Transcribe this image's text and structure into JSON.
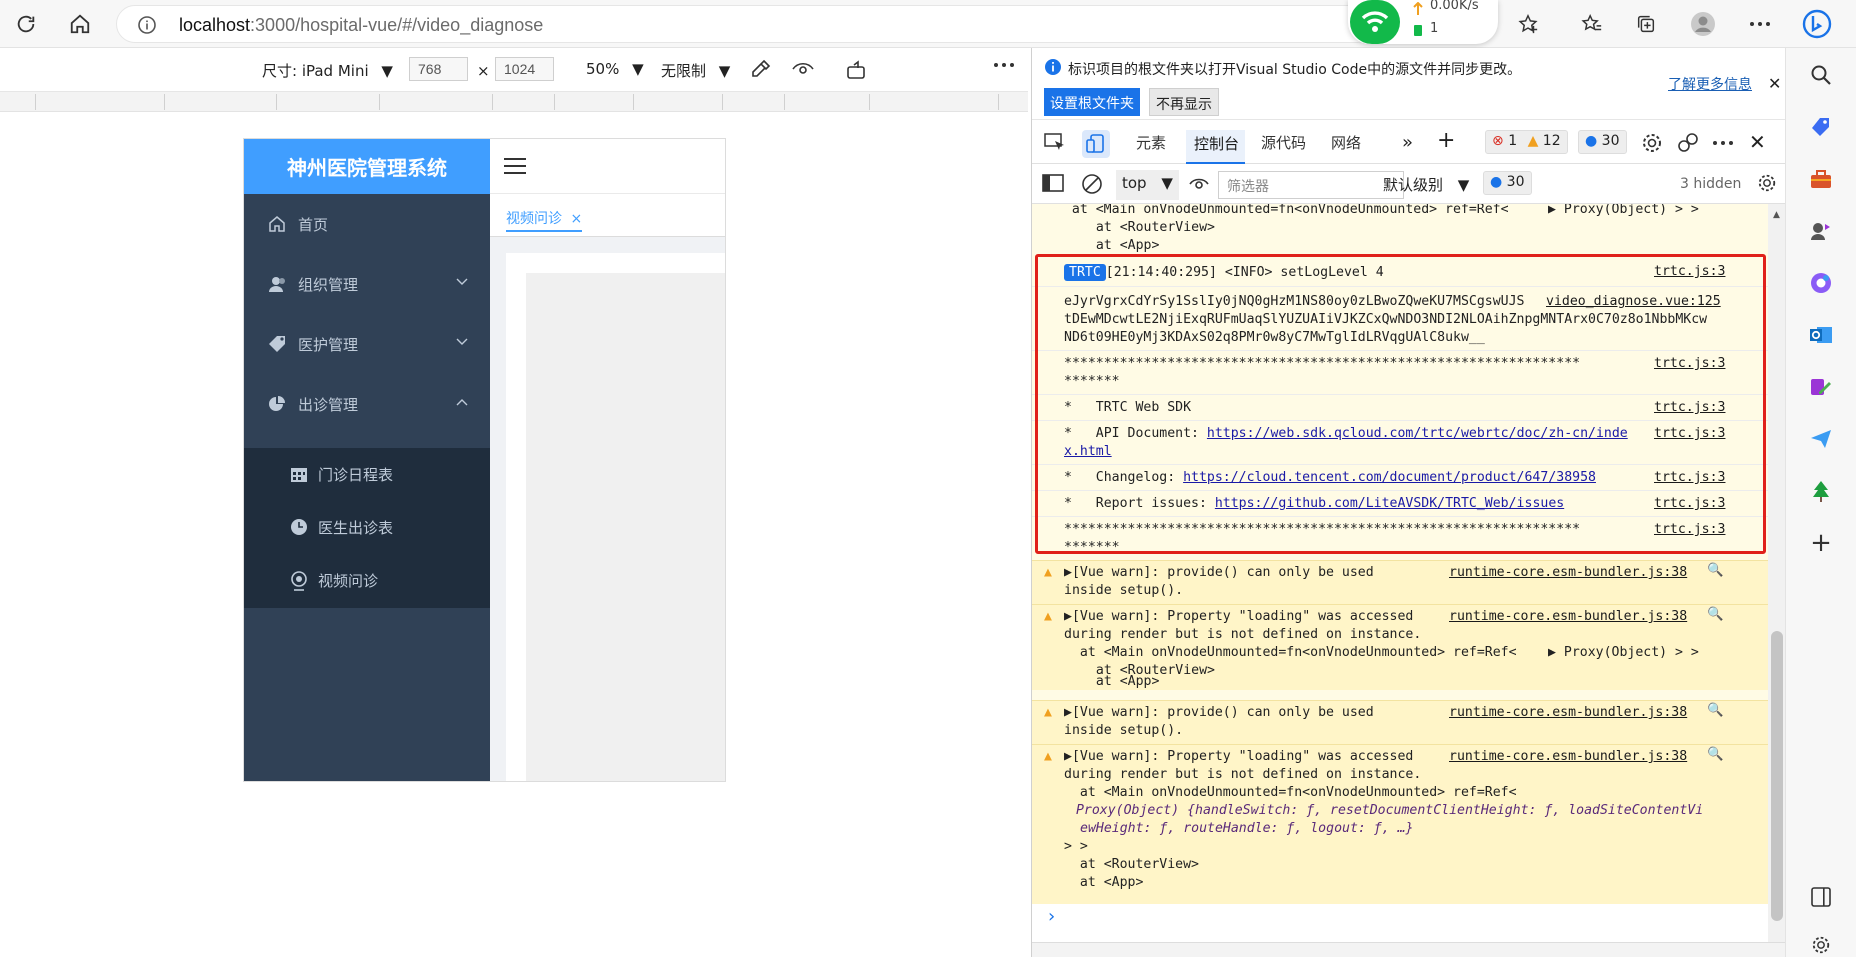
{
  "browser": {
    "url_host": "localhost",
    "url_path": ":3000/hospital-vue/#/video_diagnose",
    "net_speed": "0.00K/s",
    "net_count": "1"
  },
  "device_toolbar": {
    "size_label": "尺寸: iPad Mini",
    "width": "768",
    "times": "×",
    "height": "1024",
    "zoom": "50%",
    "throttle": "无限制"
  },
  "app": {
    "title": "神州医院管理系统",
    "menu": [
      {
        "label": "首页"
      },
      {
        "label": "组织管理"
      },
      {
        "label": "医护管理"
      },
      {
        "label": "出诊管理"
      }
    ],
    "submenu": [
      {
        "label": "门诊日程表"
      },
      {
        "label": "医生出诊表"
      },
      {
        "label": "视频问诊"
      }
    ],
    "tab_label": "视频问诊",
    "tab_close": "×"
  },
  "devtools": {
    "info_message": "标识项目的根文件夹以打开Visual Studio Code中的源文件并同步更改。",
    "set_root_button": "设置根文件夹",
    "dont_show_button": "不再显示",
    "learn_more": "了解更多信息",
    "tabs": [
      "元素",
      "控制台",
      "源代码",
      "网络"
    ],
    "errors_count": "1",
    "warnings_count": "12",
    "messages_count": "30",
    "context": "top",
    "filter_placeholder": "筛选器",
    "level": "默认级别",
    "level_count": "30",
    "hidden": "3 hidden"
  },
  "console": {
    "top_lines": [
      "  at <Main onVnodeUnmounted=fn<onVnodeUnmounted> ref=Ref< ",
      "Proxy(Object) > >",
      "  at <RouterView>",
      "  at <App>"
    ],
    "trtc_badge": "TRTC",
    "log_setlevel": "[21:14:40:295] <INFO> setLogLevel 4",
    "trtc_src": "trtc.js:3",
    "token_lines": [
      "eJyrVgrxCdYrSy1SslIy0jNQ0gHzM1NS80oy0zLBwoZQweKU7MSCgswUJS",
      "tDEwMDcwtLE2NjiExqRUFmUaqSlYUZUAIiVJKZCxQwNDO3NDI2NLOAihZnpgMNTArx0C70z8o1NbbMKcw",
      "ND6t09HE0yMj3KDAxS02q8PMr0w8yC7MwTglIdLRVqgUAlC8ukw__"
    ],
    "token_src": "video_diagnose.vue:125",
    "stars": "*****************************************************************",
    "stars_tail": "*******",
    "sdk_line": "*   TRTC Web SDK",
    "api_prefix": "*   API Document: ",
    "api_link_a": "https://web.sdk.qcloud.com/trtc/webrtc/doc/zh-cn/inde",
    "api_link_b": "x.html",
    "changelog_prefix": "*   Changelog: ",
    "changelog_link": "https://cloud.tencent.com/document/product/647/38958",
    "issues_prefix": "*   Report issues: ",
    "issues_link": "https://github.com/LiteAVSDK/TRTC_Web/issues",
    "warn_src": "runtime-core.esm-bundler.js:38",
    "warn_provide_a": "[Vue warn]: provide() can only be used",
    "warn_provide_b": "inside setup().",
    "warn_loading_a": "[Vue warn]: Property \"loading\" was accessed",
    "warn_loading_b": "during render but is not defined on instance.",
    "main_line": "  at <Main onVnodeUnmounted=fn<onVnodeUnmounted> ref=Ref< ",
    "proxy_short": "Proxy(Object) > >",
    "router_view": "  at <RouterView>",
    "app_line": "  at <App>",
    "main_line2": "  at <Main onVnodeUnmounted=fn<onVnodeUnmounted> ref=Ref<",
    "proxy_long_a": "Proxy(Object) {handleSwitch: ƒ, resetDocumentClientHeight: ƒ, loadSiteContentVi",
    "proxy_long_b": "ewHeight: ƒ, routeHandle: ƒ, logout: ƒ, …}",
    "close_brackets": "> >",
    "prompt": "›"
  },
  "colors": {
    "accent": "#409eff",
    "sidebar": "#304156",
    "submenu": "#1f2d3d",
    "highlight": "#e0201a",
    "console_bg": "#fffbe5"
  }
}
